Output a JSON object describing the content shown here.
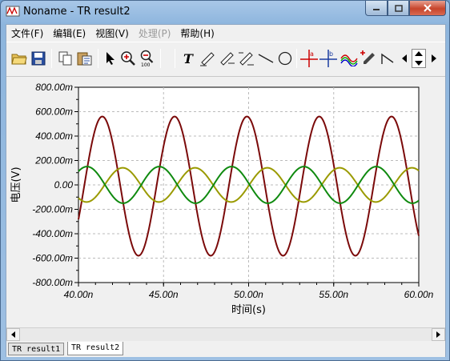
{
  "window": {
    "title": "Noname - TR result2"
  },
  "menu": [
    "文件(F)",
    "编辑(E)",
    "视图(V)",
    "处理(P)",
    "帮助(H)"
  ],
  "menu_disabled": [
    false,
    false,
    false,
    true,
    false
  ],
  "toolbar": {
    "icons": [
      "open-folder-icon",
      "save-icon",
      "copy-icon",
      "paste-icon",
      "pointer-icon",
      "zoom-in-icon",
      "zoom-out-icon",
      "text-tool-icon",
      "annotate-pen-icon",
      "annotate-pen-2-icon",
      "annotate-pen-3-icon",
      "line-tool-icon",
      "ellipse-tool-icon",
      "cursor-a-icon",
      "cursor-b-icon",
      "curves-icon",
      "marker-icon",
      "arrow-step-icon",
      "nav-left-icon",
      "nav-updown-icon",
      "nav-right-icon"
    ]
  },
  "tabs": [
    "TR result1",
    "TR result2"
  ],
  "active_tab": 1,
  "colors": {
    "series1": "#7b0a0a",
    "series2": "#9a9a00",
    "series3": "#0f8a0f"
  },
  "chart_data": {
    "type": "line",
    "xlabel": "时间(s)",
    "ylabel": "电压(V)",
    "xlim": [
      4e-08,
      6e-08
    ],
    "ylim": [
      -0.8,
      0.8
    ],
    "xticks": [
      "40.00n",
      "45.00n",
      "50.00n",
      "55.00n",
      "60.00n"
    ],
    "xtick_values": [
      4e-08,
      4.5e-08,
      5e-08,
      5.5e-08,
      6e-08
    ],
    "yticks": [
      "800.00m",
      "600.00m",
      "400.00m",
      "200.00m",
      "0.00",
      "-200.00m",
      "-400.00m",
      "-600.00m",
      "-800.00m"
    ],
    "ytick_values": [
      0.8,
      0.6,
      0.4,
      0.2,
      0,
      -0.2,
      -0.4,
      -0.6,
      -0.8
    ],
    "grid": true,
    "series": [
      {
        "color": "#7b0a0a",
        "amplitude": 0.57,
        "period_ns": 4.25,
        "peak_time_ns": 41.4,
        "offset": -0.01
      },
      {
        "color": "#9a9a00",
        "amplitude": 0.14,
        "period_ns": 4.25,
        "peak_time_ns": 42.6,
        "offset": 0.0
      },
      {
        "color": "#0f8a0f",
        "amplitude": 0.15,
        "period_ns": 4.25,
        "peak_time_ns": 40.5,
        "offset": 0.0
      }
    ]
  }
}
